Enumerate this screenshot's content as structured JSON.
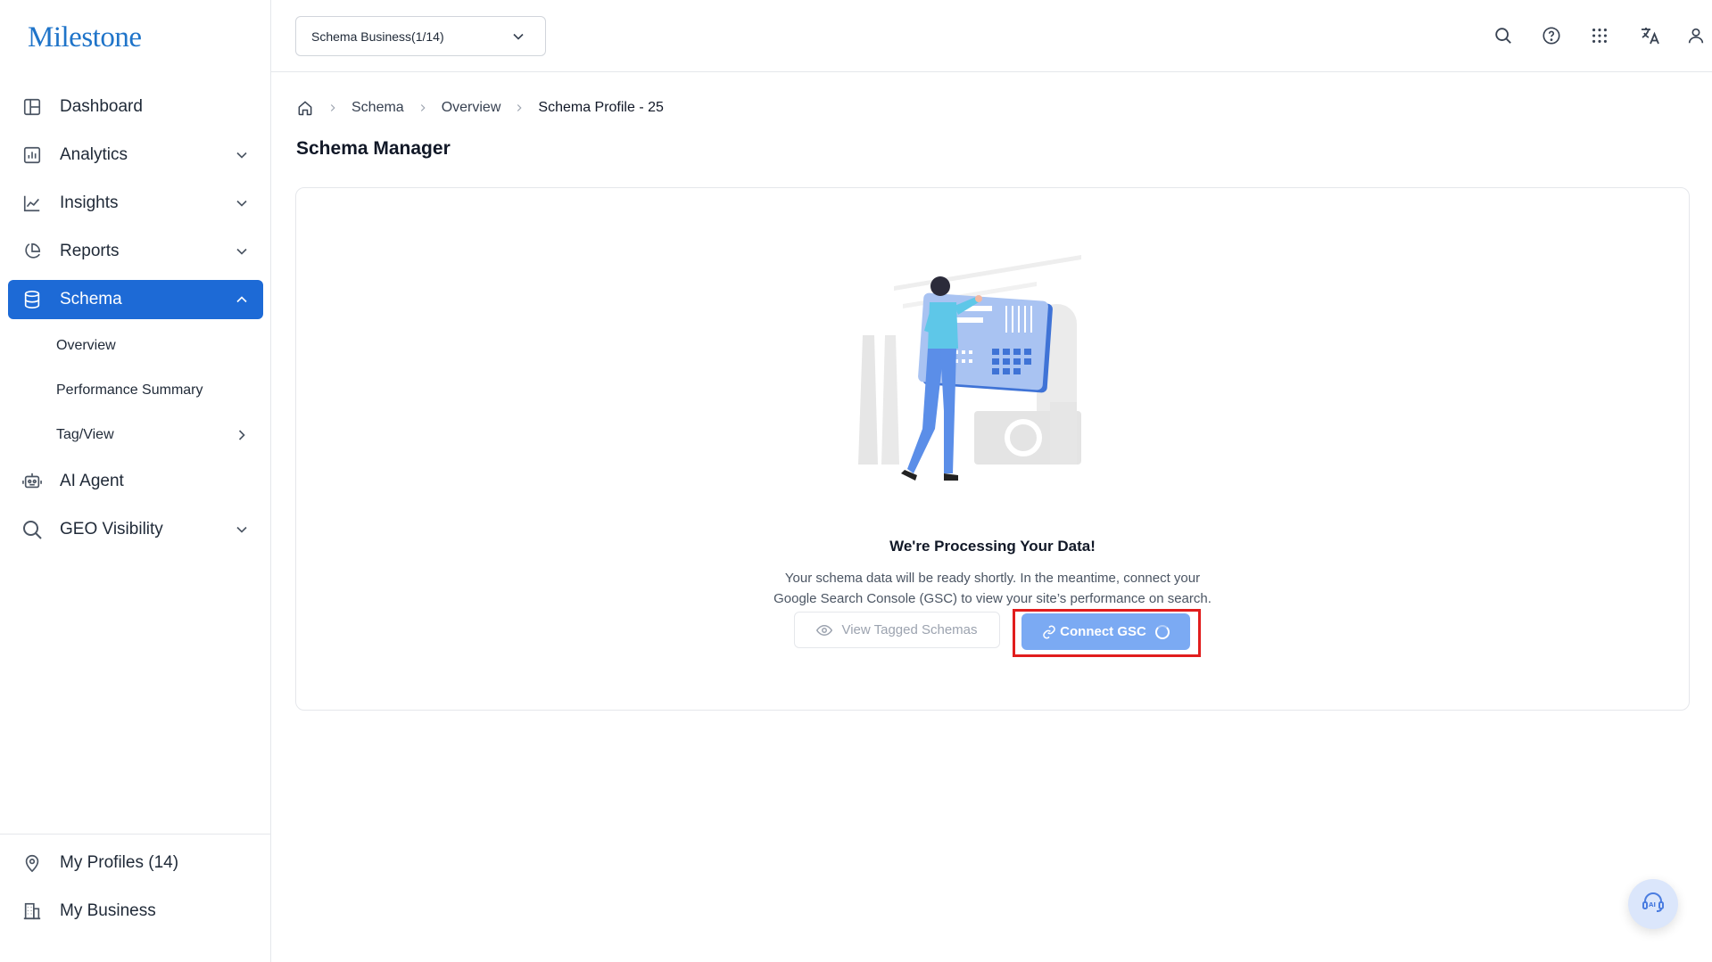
{
  "brand": {
    "logo_text": "Milestone",
    "accent": "#1d6ad6",
    "highlight": "#e11d1d"
  },
  "sidebar": {
    "items": [
      {
        "label": "Dashboard",
        "icon": "dashboard-icon",
        "chevron": "none"
      },
      {
        "label": "Analytics",
        "icon": "bar-chart-icon",
        "chevron": "down"
      },
      {
        "label": "Insights",
        "icon": "line-chart-icon",
        "chevron": "down"
      },
      {
        "label": "Reports",
        "icon": "pie-chart-icon",
        "chevron": "down"
      },
      {
        "label": "Schema",
        "icon": "database-icon",
        "chevron": "up",
        "active": true
      }
    ],
    "schema_sub": [
      {
        "label": "Overview"
      },
      {
        "label": "Performance Summary"
      },
      {
        "label": "Tag/View",
        "chevron": "right"
      }
    ],
    "items_after": [
      {
        "label": "AI Agent",
        "icon": "robot-icon",
        "chevron": "none"
      },
      {
        "label": "GEO Visibility",
        "icon": "search-icon",
        "chevron": "down"
      }
    ],
    "bottom": [
      {
        "label": "My Profiles (14)",
        "icon": "location-pin-icon"
      },
      {
        "label": "My Business",
        "icon": "building-icon"
      }
    ]
  },
  "header": {
    "business_select": "Schema Business(1/14)",
    "icons": [
      "search-icon",
      "help-icon",
      "apps-grid-icon",
      "translate-icon",
      "user-icon"
    ]
  },
  "breadcrumb": {
    "items": [
      "Schema",
      "Overview"
    ],
    "current": "Schema Profile - 25"
  },
  "page_title": "Schema Manager",
  "empty_state": {
    "title": "We're Processing Your Data!",
    "line1": "Your schema data will be ready shortly. In the meantime, connect your",
    "line2": "Google Search Console (GSC) to view your site’s performance on search.",
    "view_button": "View Tagged Schemas",
    "connect_button": "Connect GSC"
  }
}
